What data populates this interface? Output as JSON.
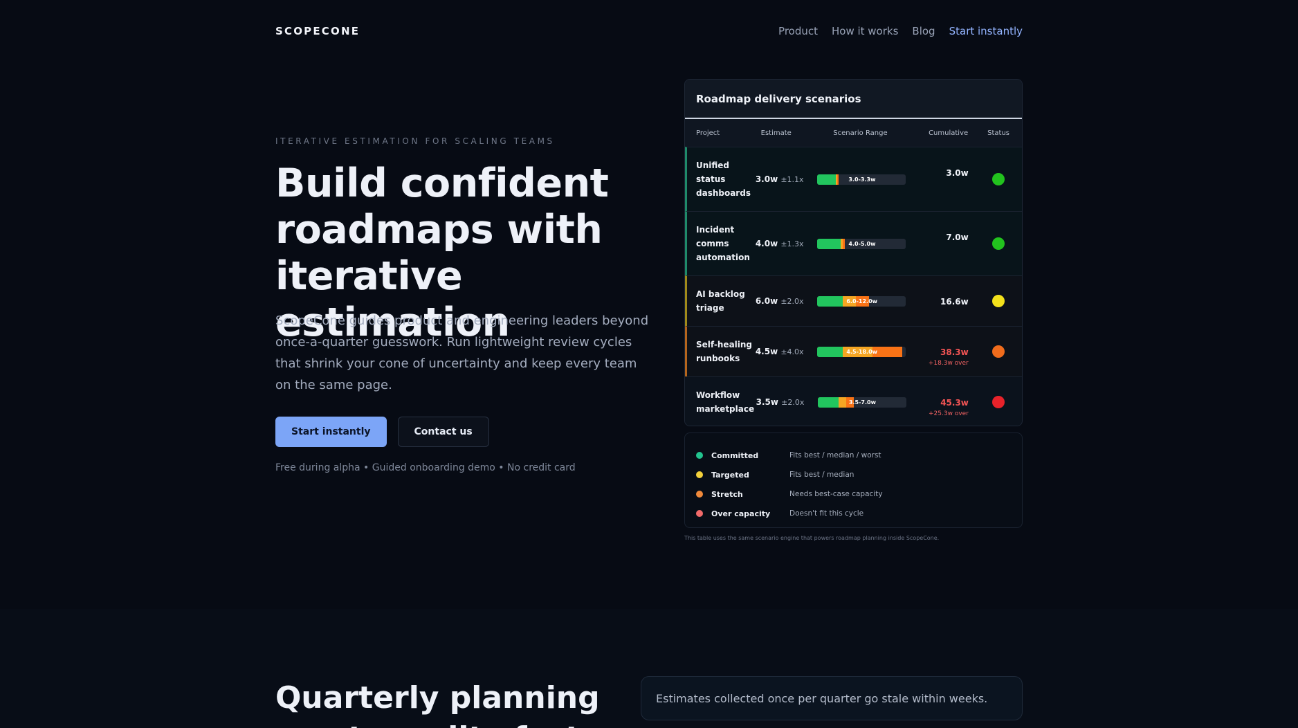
{
  "header": {
    "brand": "SCOPECONE",
    "nav": [
      "Product",
      "How it works",
      "Blog"
    ],
    "cta": "Start instantly"
  },
  "hero": {
    "eyebrow": "ITERATIVE ESTIMATION FOR SCALING TEAMS",
    "title": "Build confident roadmaps with iterative estimation",
    "subtitle": "ScopeCone guides product and engineering leaders beyond once-a-quarter guesswork. Run lightweight review cycles that shrink your cone of uncertainty and keep every team on the same page.",
    "primary_button": "Start instantly",
    "secondary_button": "Contact us",
    "fine_print": "Free during alpha • Guided onboarding demo • No credit card"
  },
  "table": {
    "title": "Roadmap delivery scenarios",
    "columns": [
      "Project",
      "Estimate",
      "Scenario Range",
      "Cumulative",
      "Status"
    ],
    "rows": [
      {
        "project": "Unified status dashboards",
        "estimate": "3.0w",
        "factor": "±1.1x",
        "range": "3.0-3.3w",
        "best": 3.0,
        "worst": 3.3,
        "cumulative": "3.0w",
        "over": "",
        "status": "Committed",
        "status_color": "#22c31e",
        "accent": "#1f8a6a"
      },
      {
        "project": "Incident comms automation",
        "estimate": "4.0w",
        "factor": "±1.3x",
        "range": "4.0-5.0w",
        "best": 4.0,
        "worst": 5.0,
        "cumulative": "7.0w",
        "over": "",
        "status": "Committed",
        "status_color": "#22c31e",
        "accent": "#1f8a6a"
      },
      {
        "project": "AI backlog triage",
        "estimate": "6.0w",
        "factor": "±2.0x",
        "range": "6.0-12.0w",
        "best": 6.0,
        "worst": 12.0,
        "cumulative": "16.6w",
        "over": "",
        "status": "Targeted",
        "status_color": "#f3e11b",
        "accent": "#a08a1a"
      },
      {
        "project": "Self-healing runbooks",
        "estimate": "4.5w",
        "factor": "±4.0x",
        "range": "4.5-18.0w",
        "best": 4.5,
        "worst": 18.0,
        "cumulative": "38.3w",
        "over": "+18.3w over",
        "status": "Stretch",
        "status_color": "#f06c1c",
        "accent": "#b5651d"
      },
      {
        "project": "Workflow marketplace",
        "estimate": "3.5w",
        "factor": "±2.0x",
        "range": "3.5-7.0w",
        "best": 3.5,
        "worst": 7.0,
        "cumulative": "45.3w",
        "over": "+25.3w over",
        "status": "Over capacity",
        "status_color": "#e8222a",
        "accent": "transparent"
      }
    ]
  },
  "legend": [
    {
      "name": "Committed",
      "desc": "Fits best / median / worst",
      "color": "#22c38e"
    },
    {
      "name": "Targeted",
      "desc": "Fits best / median",
      "color": "#f3d03b"
    },
    {
      "name": "Stretch",
      "desc": "Needs best-case capacity",
      "color": "#f0893b"
    },
    {
      "name": "Over capacity",
      "desc": "Doesn't fit this cycle",
      "color": "#f26a6a"
    }
  ],
  "footnote": "This table uses the same scenario engine that powers roadmap planning inside ScopeCone.",
  "section2": {
    "title": "Quarterly planning meets reality fast",
    "card_text": "Estimates collected once per quarter go stale within weeks."
  }
}
